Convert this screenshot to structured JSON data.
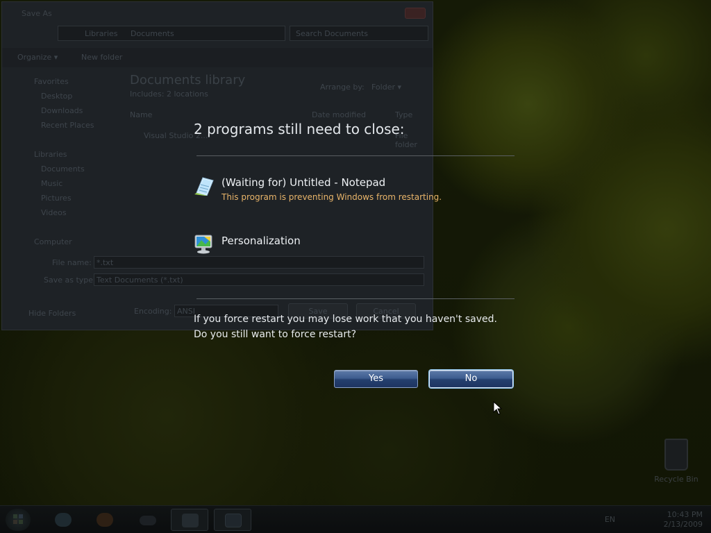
{
  "save_dialog": {
    "title": "Save As",
    "breadcrumb": [
      "Libraries",
      "Documents"
    ],
    "search_placeholder": "Search Documents",
    "toolbar": {
      "organize": "Organize ▾",
      "new_folder": "New folder"
    },
    "nav": {
      "favorites": "Favorites",
      "desktop": "Desktop",
      "downloads": "Downloads",
      "recent_places": "Recent Places",
      "libraries": "Libraries",
      "documents": "Documents",
      "music": "Music",
      "pictures": "Pictures",
      "videos": "Videos",
      "computer": "Computer"
    },
    "library_title": "Documents library",
    "library_includes": "Includes: 2 locations",
    "arrange_by_label": "Arrange by:",
    "arrange_by_value": "Folder ▾",
    "columns": {
      "name": "Name",
      "date_modified": "Date modified",
      "type": "Type"
    },
    "file_row": {
      "name": "Visual Studio 2...",
      "type": "File folder"
    },
    "file_name_label": "File name:",
    "file_name_value": "*.txt",
    "save_as_type_label": "Save as type:",
    "save_as_type_value": "Text Documents (*.txt)",
    "hide_folders": "Hide Folders",
    "encoding_label": "Encoding:",
    "encoding_value": "ANSI",
    "save_button": "Save",
    "cancel_button": "Cancel"
  },
  "dialog": {
    "heading": "2 programs still need to close:",
    "programs": [
      {
        "name": "(Waiting for) Untitled - Notepad",
        "note": "This program is preventing Windows from restarting.",
        "icon": "notepad-icon"
      },
      {
        "name": "Personalization",
        "note": "",
        "icon": "personalization-icon"
      }
    ],
    "warning_line1": "If you force restart you may lose work that you haven't saved.",
    "warning_line2": "Do you still want to force restart?",
    "yes_button": "Yes",
    "no_button": "No"
  },
  "desktop": {
    "recycle_bin_label": "Recycle Bin"
  },
  "taskbar": {
    "items": [
      "start-orb",
      "ie-icon",
      "firefox-icon",
      "gamepad-icon",
      "explorer-icon",
      "personalization-icon"
    ],
    "tray_text": "EN",
    "clock_time": "10:43 PM",
    "clock_date": "2/13/2009"
  },
  "colors": {
    "heading": "#e4e8ec",
    "warning_note": "#e8b46a",
    "button_gradient_top": "#5d7aa8",
    "button_gradient_bottom": "#1e3562"
  }
}
